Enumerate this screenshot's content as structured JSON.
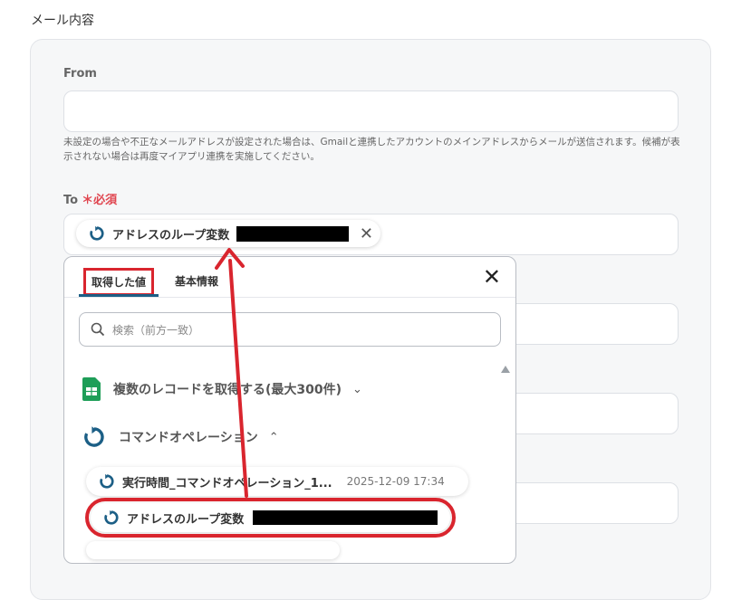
{
  "section_title": "メール内容",
  "from": {
    "label": "From",
    "value": ""
  },
  "from_help": "未設定の場合や不正なメールアドレスが設定された場合は、Gmailと連携したアカウントのメインアドレスからメールが送信されます。候補が表示されない場合は再度マイアプリ連携を実施してください。",
  "to": {
    "label": "To",
    "required_mark": "＊必須",
    "chip_label": "アドレスのループ変数",
    "chip_remove": "✕"
  },
  "panel": {
    "tabs": [
      {
        "label": "取得した値",
        "active": true
      },
      {
        "label": "基本情報",
        "active": false
      }
    ],
    "close": "✕",
    "search_placeholder": "検索（前方一致）",
    "groups": [
      {
        "label": "複数のレコードを取得する(最大300件)",
        "icon": "google-sheets-icon",
        "expanded": false,
        "chevron": "⌄"
      },
      {
        "label": "コマンドオペレーション",
        "icon": "loop-icon",
        "expanded": true,
        "chevron": "⌃"
      }
    ],
    "items": [
      {
        "label": "実行時間_コマンドオペレーション_1...",
        "time": "2025-12-09 17:34"
      },
      {
        "label": "アドレスのループ変数"
      }
    ]
  },
  "colors": {
    "highlight_red": "#d9252e",
    "accent_teal": "#1c5f86",
    "required_red": "#e0454f"
  }
}
